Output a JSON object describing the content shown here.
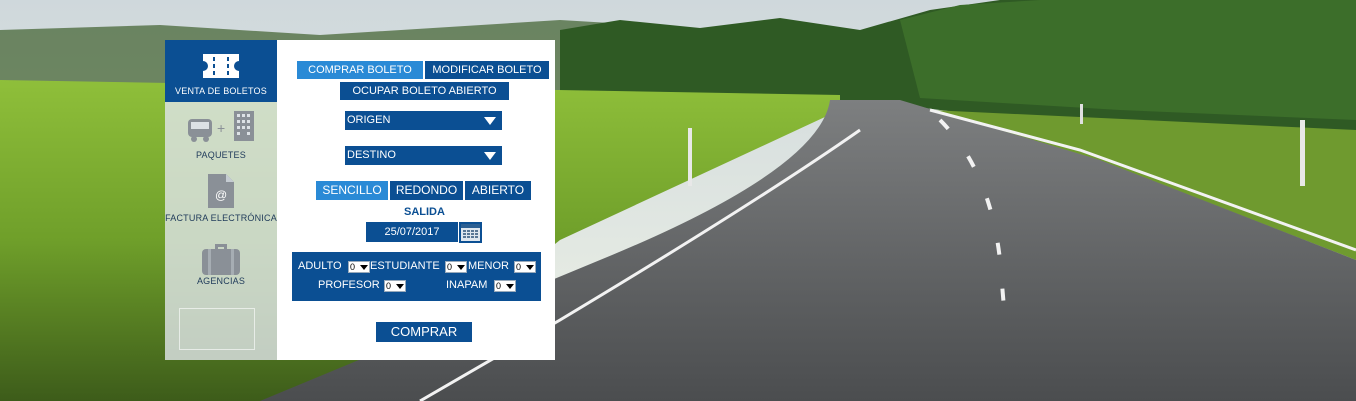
{
  "sidebar": {
    "items": [
      {
        "label": "VENTA DE BOLETOS",
        "icon": "ticket-icon"
      },
      {
        "label": "PAQUETES",
        "icon": "bus-hotel-icon"
      },
      {
        "label": "FACTURA ELECTRÓNICA",
        "icon": "invoice-file-icon"
      },
      {
        "label": "AGENCIAS",
        "icon": "briefcase-icon"
      }
    ]
  },
  "tabs": {
    "comprar": "COMPRAR BOLETO",
    "modificar": "MODIFICAR BOLETO",
    "ocupar": "OCUPAR BOLETO ABIERTO"
  },
  "form": {
    "origen": "ORIGEN",
    "destino": "DESTINO",
    "trip_types": [
      "SENCILLO",
      "REDONDO",
      "ABIERTO"
    ],
    "salida_label": "SALIDA",
    "salida_date": "25/07/2017",
    "passengers": {
      "adulto": {
        "label": "ADULTO",
        "value": "0"
      },
      "estudiante": {
        "label": "ESTUDIANTE",
        "value": "0"
      },
      "menor": {
        "label": "MENOR",
        "value": "0"
      },
      "profesor": {
        "label": "PROFESOR",
        "value": "0"
      },
      "inapam": {
        "label": "INAPAM",
        "value": "0"
      }
    },
    "buy_label": "COMPRAR"
  },
  "colors": {
    "primary": "#0b4f93",
    "active_tab": "#2a8ad6",
    "sidebar_bg": "#e1e6eb"
  }
}
